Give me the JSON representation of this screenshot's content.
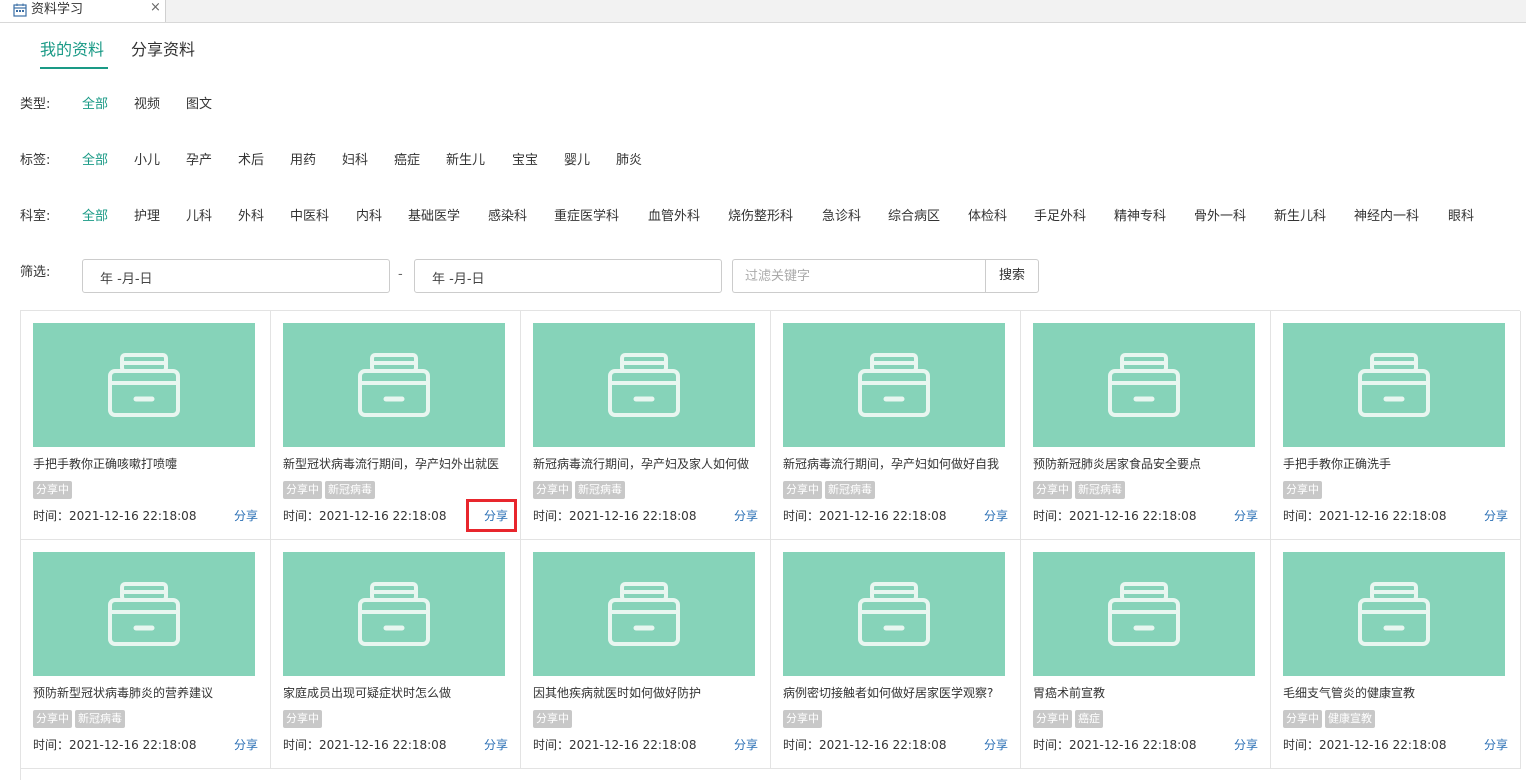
{
  "window_tab": {
    "title": "资料学习",
    "close": "×"
  },
  "main_tabs": [
    {
      "label": "我的资料",
      "active": true
    },
    {
      "label": "分享资料",
      "active": false
    }
  ],
  "filters": {
    "type": {
      "label": "类型:",
      "options": [
        "全部",
        "视频",
        "图文"
      ],
      "selected": "全部"
    },
    "tag": {
      "label": "标签:",
      "options": [
        "全部",
        "小儿",
        "孕产",
        "术后",
        "用药",
        "妇科",
        "癌症",
        "新生儿",
        "宝宝",
        "婴儿",
        "肺炎"
      ],
      "selected": "全部"
    },
    "department": {
      "label": "科室:",
      "options": [
        "全部",
        "护理",
        "儿科",
        "外科",
        "中医科",
        "内科",
        "基础医学",
        "感染科",
        "重症医学科",
        "血管外科",
        "烧伤整形科",
        "急诊科",
        "综合病区",
        "体检科",
        "手足外科",
        "精神专科",
        "骨外一科",
        "新生儿科",
        "神经内一科",
        "眼科"
      ],
      "selected": "全部"
    },
    "screen": {
      "label": "筛选:",
      "date_start": "年 -月-日",
      "date_sep": "-",
      "date_end": "年 -月-日",
      "keyword_placeholder": "过滤关键字",
      "search_button": "搜索"
    }
  },
  "cards": [
    {
      "title": "手把手教你正确咳嗽打喷嚏",
      "tags": [
        "分享中"
      ],
      "time": "时间：2021-12-16 22:18:08",
      "action": "分享"
    },
    {
      "title": "新型冠状病毒流行期间，孕产妇外出就医",
      "tags": [
        "分享中",
        "新冠病毒"
      ],
      "time": "时间：2021-12-16 22:18:08",
      "action": "分享"
    },
    {
      "title": "新冠病毒流行期间，孕产妇及家人如何做",
      "tags": [
        "分享中",
        "新冠病毒"
      ],
      "time": "时间：2021-12-16 22:18:08",
      "action": "分享"
    },
    {
      "title": "新冠病毒流行期间，孕产妇如何做好自我",
      "tags": [
        "分享中",
        "新冠病毒"
      ],
      "time": "时间：2021-12-16 22:18:08",
      "action": "分享"
    },
    {
      "title": "预防新冠肺炎居家食品安全要点",
      "tags": [
        "分享中",
        "新冠病毒"
      ],
      "time": "时间：2021-12-16 22:18:08",
      "action": "分享"
    },
    {
      "title": "手把手教你正确洗手",
      "tags": [
        "分享中"
      ],
      "time": "时间：2021-12-16 22:18:08",
      "action": "分享"
    },
    {
      "title": "预防新型冠状病毒肺炎的营养建议",
      "tags": [
        "分享中",
        "新冠病毒"
      ],
      "time": "时间：2021-12-16 22:18:08",
      "action": "分享"
    },
    {
      "title": "家庭成员出现可疑症状时怎么做",
      "tags": [
        "分享中"
      ],
      "time": "时间：2021-12-16 22:18:08",
      "action": "分享"
    },
    {
      "title": "因其他疾病就医时如何做好防护",
      "tags": [
        "分享中"
      ],
      "time": "时间：2021-12-16 22:18:08",
      "action": "分享"
    },
    {
      "title": "病例密切接触者如何做好居家医学观察?",
      "tags": [
        "分享中"
      ],
      "time": "时间：2021-12-16 22:18:08",
      "action": "分享"
    },
    {
      "title": "胃癌术前宣教",
      "tags": [
        "分享中",
        "癌症"
      ],
      "time": "时间：2021-12-16 22:18:08",
      "action": "分享"
    },
    {
      "title": "毛细支气管炎的健康宣教",
      "tags": [
        "分享中",
        "健康宣教"
      ],
      "time": "时间：2021-12-16 22:18:08",
      "action": "分享"
    }
  ],
  "colors": {
    "accent": "#1a9a86",
    "thumbnail": "#86d3b9",
    "tag_bg": "#c8c8c8",
    "link": "#2a6fb5",
    "highlight": "#e8262d"
  }
}
